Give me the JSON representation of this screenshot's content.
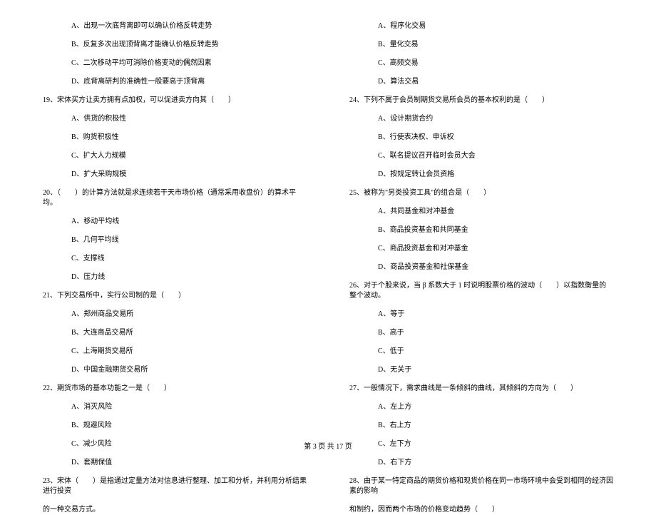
{
  "left_column": {
    "prev_options": [
      "A、出现一次底背离即可以确认价格反转走势",
      "B、反复多次出现顶背离才能确认价格反转走势",
      "C、二次移动平均可消除价格变动的偶然因素",
      "D、底背离研判的准确性一般要高于顶背离"
    ],
    "q19": {
      "stem": "19、宋体买方让卖方拥有点加权，可以促进卖方向其（　　）",
      "options": [
        "A、供货的积极性",
        "B、购货积极性",
        "C、扩大人力规模",
        "D、扩大采购规模"
      ]
    },
    "q20": {
      "stem": "20、（　　）的计算方法就是求连续若干天市场价格（通常采用收盘价）的算术平均。",
      "options": [
        "A、移动平均线",
        "B、几何平均线",
        "C、支撑线",
        "D、压力线"
      ]
    },
    "q21": {
      "stem": "21、下列交易所中，实行公司制的是（　　）",
      "options": [
        "A、郑州商品交易所",
        "B、大连商品交易所",
        "C、上海期货交易所",
        "D、中国金融期货交易所"
      ]
    },
    "q22": {
      "stem": "22、期货市场的基本功能之一是（　　）",
      "options": [
        "A、消灭风险",
        "B、规避风险",
        "C、减少风险",
        "D、套期保值"
      ]
    },
    "q23": {
      "stem": "23、宋体（　　）是指通过定量方法对信息进行整理、加工和分析，并利用分析结果进行投资",
      "continuation": "的一种交易方式。"
    }
  },
  "right_column": {
    "prev_options": [
      "A、程序化交易",
      "B、量化交易",
      "C、高频交易",
      "D、算法交易"
    ],
    "q24": {
      "stem": "24、下列不属于会员制期货交易所会员的基本权利的是（　　）",
      "options": [
        "A、设计期货合约",
        "B、行使表决权、申诉权",
        "C、联名提议召开临时会员大会",
        "D、按规定转让会员资格"
      ]
    },
    "q25": {
      "stem": "25、被称为\"另类投资工具\"的组合是（　　）",
      "options": [
        "A、共同基金和对冲基金",
        "B、商品投资基金和共同基金",
        "C、商品投资基金和对冲基金",
        "D、商品投资基金和社保基金"
      ]
    },
    "q26": {
      "stem": "26、对于个股来说，当 β 系数大于 1 时说明股票价格的波动（　　）以指数衡量的整个波动。",
      "options": [
        "A、等于",
        "B、高于",
        "C、低于",
        "D、无关于"
      ]
    },
    "q27": {
      "stem": "27、一般情况下，需求曲线是一条倾斜的曲线，其倾斜的方向为（　　）",
      "options": [
        "A、左上方",
        "B、右上方",
        "C、左下方",
        "D、右下方"
      ]
    },
    "q28": {
      "stem": "28、由于某一特定商品的期货价格和现货价格在同一市场环境中会受到相同的经济因素的影响",
      "continuation": "和制约，因而两个市场的价格变动趋势（　　）"
    }
  },
  "footer": "第 3 页 共 17 页"
}
